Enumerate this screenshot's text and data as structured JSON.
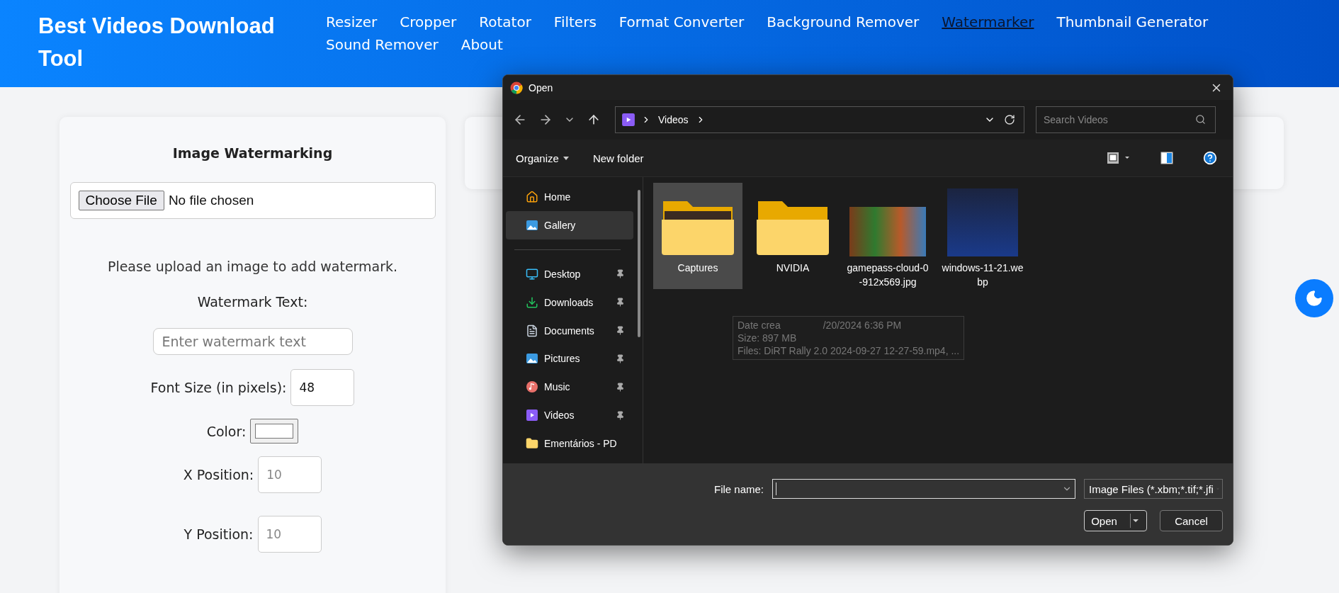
{
  "header": {
    "logo": "Best Videos Download Tool",
    "nav": [
      {
        "label": "Resizer",
        "selected": false
      },
      {
        "label": "Cropper",
        "selected": false
      },
      {
        "label": "Rotator",
        "selected": false
      },
      {
        "label": "Filters",
        "selected": false
      },
      {
        "label": "Format Converter",
        "selected": false
      },
      {
        "label": "Background Remover",
        "selected": false
      },
      {
        "label": "Watermarker",
        "selected": true
      },
      {
        "label": "Thumbnail Generator",
        "selected": false
      },
      {
        "label": "Sound Remover",
        "selected": false
      },
      {
        "label": "About",
        "selected": false
      }
    ]
  },
  "watermark_panel": {
    "title": "Image Watermarking",
    "file_button": "Choose File",
    "file_status": "No file chosen",
    "notice": "Please upload an image to add watermark.",
    "text_label": "Watermark Text:",
    "text_placeholder": "Enter watermark text",
    "fields": [
      {
        "kind": "number",
        "label": "Font Size (in pixels):",
        "value": "48"
      },
      {
        "kind": "color",
        "label": "Color:",
        "color": "#ffffff"
      },
      {
        "kind": "number",
        "label": "X Position:",
        "placeholder": "10"
      },
      {
        "kind": "number",
        "label": "Y Position:",
        "placeholder": "10"
      }
    ]
  },
  "dialog": {
    "title": "Open",
    "path": "Videos",
    "search_placeholder": "Search Videos",
    "organize": "Organize",
    "new_folder": "New folder",
    "sidebar": [
      {
        "label": "Home",
        "selected": false,
        "pinned": false
      },
      {
        "label": "Gallery",
        "selected": true,
        "pinned": false
      },
      {
        "label": "Desktop",
        "selected": false,
        "pinned": true
      },
      {
        "label": "Downloads",
        "selected": false,
        "pinned": true
      },
      {
        "label": "Documents",
        "selected": false,
        "pinned": true
      },
      {
        "label": "Pictures",
        "selected": false,
        "pinned": true
      },
      {
        "label": "Music",
        "selected": false,
        "pinned": true
      },
      {
        "label": "Videos",
        "selected": false,
        "pinned": true
      },
      {
        "label": "Ementários - PD",
        "selected": false,
        "pinned": false
      }
    ],
    "files": [
      {
        "kind": "photo-folder",
        "name": "Captures",
        "selected": true
      },
      {
        "kind": "folder",
        "name": "NVIDIA",
        "selected": false
      },
      {
        "kind": "landscape-image",
        "name": "gamepass-cloud-0-912x569.jpg",
        "selected": false
      },
      {
        "kind": "square-image",
        "name": "windows-11-21.webp",
        "selected": false
      }
    ],
    "tooltip": {
      "line_1_start": "Date crea",
      "line_1_end": "/20/2024 6:36 PM",
      "line_2": "Size: 897 MB",
      "line_3": "Files: DiRT Rally 2.0 2024-09-27 12-27-59.mp4, ..."
    },
    "file_name_label": "File name:",
    "file_type": "Image Files (*.xbm;*.tif;*.jfi",
    "open_button": "Open",
    "cancel_button": "Cancel"
  }
}
